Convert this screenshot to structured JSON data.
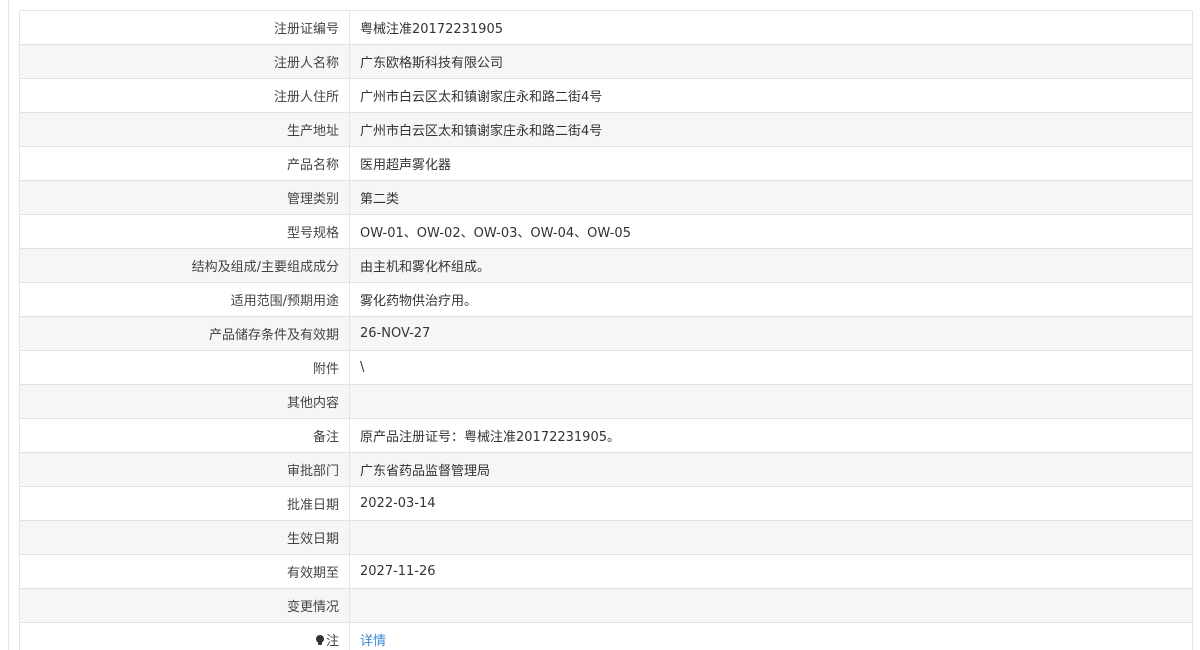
{
  "rows": [
    {
      "label": "注册证编号",
      "value": "粤械注准20172231905"
    },
    {
      "label": "注册人名称",
      "value": "广东欧格斯科技有限公司"
    },
    {
      "label": "注册人住所",
      "value": "广州市白云区太和镇谢家庄永和路二街4号"
    },
    {
      "label": "生产地址",
      "value": "广州市白云区太和镇谢家庄永和路二街4号"
    },
    {
      "label": "产品名称",
      "value": "医用超声雾化器"
    },
    {
      "label": "管理类别",
      "value": "第二类"
    },
    {
      "label": "型号规格",
      "value": "OW-01、OW-02、OW-03、OW-04、OW-05"
    },
    {
      "label": "结构及组成/主要组成成分",
      "value": "由主机和雾化杯组成。"
    },
    {
      "label": "适用范围/预期用途",
      "value": "雾化药物供治疗用。"
    },
    {
      "label": "产品储存条件及有效期",
      "value": "26-NOV-27"
    },
    {
      "label": "附件",
      "value": "\\"
    },
    {
      "label": "其他内容",
      "value": ""
    },
    {
      "label": "备注",
      "value": "原产品注册证号：粤械注准20172231905。"
    },
    {
      "label": "审批部门",
      "value": "广东省药品监督管理局"
    },
    {
      "label": "批准日期",
      "value": "2022-03-14"
    },
    {
      "label": "生效日期",
      "value": ""
    },
    {
      "label": "有效期至",
      "value": "2027-11-26"
    },
    {
      "label": "变更情况",
      "value": ""
    }
  ],
  "note": {
    "icon": "bulb-icon",
    "label": "注",
    "link_text": "详情"
  },
  "colors": {
    "link": "#3a8ad8",
    "row_alt": "#f6f6f6",
    "border": "#e3e3e3"
  }
}
